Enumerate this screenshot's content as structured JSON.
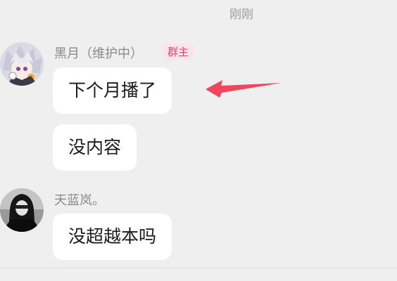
{
  "timestamp": "刚刚",
  "messages": [
    {
      "sender": "黑月（维护中）",
      "role_badge": "群主",
      "avatar_icon": "anime-character-avatar",
      "bubbles": [
        "下个月播了",
        "没内容"
      ]
    },
    {
      "sender": "天蓝岚。",
      "avatar_icon": "dark-portrait-avatar",
      "bubbles": [
        "没超越本吗"
      ]
    }
  ],
  "annotation": {
    "icon": "red-arrow-icon",
    "color": "#f0475f"
  },
  "colors": {
    "background": "#efefef",
    "bubble": "#ffffff",
    "badge_bg": "#fde3ea",
    "badge_text": "#e2476b"
  }
}
